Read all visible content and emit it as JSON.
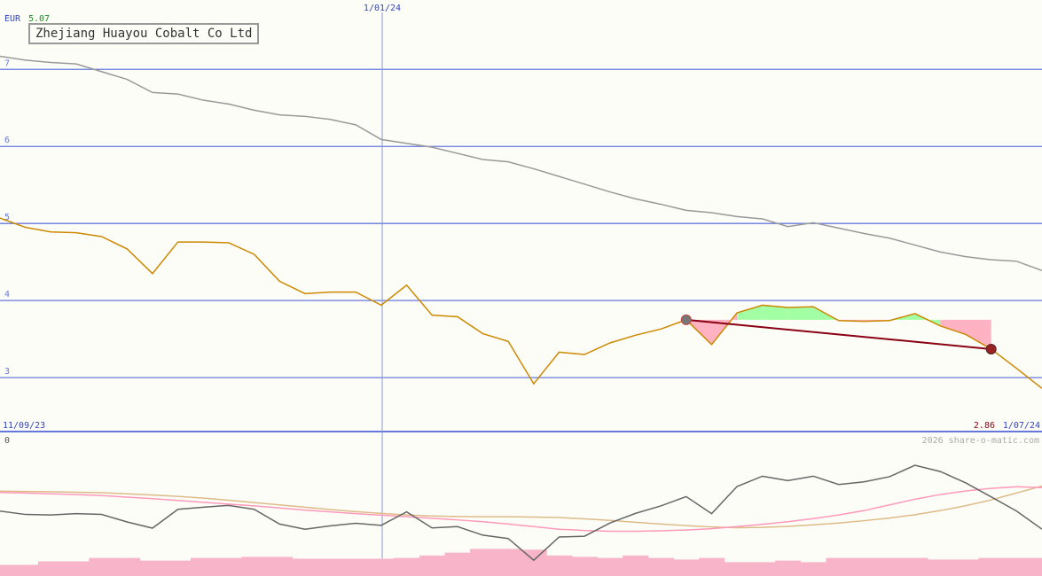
{
  "header": {
    "currency": "EUR",
    "last_price": "5.07",
    "company": "Zhejiang Huayou Cobalt Co Ltd",
    "start_date": "11/09/23",
    "end_date": "1/07/24",
    "end_price": "2.86",
    "marker_date": "1/01/24",
    "credit": "2026 share-o-matic.com"
  },
  "colors": {
    "price": "#cc8800",
    "average": "#999999",
    "gridline": "#6677dd",
    "trend": "#880011",
    "gain_fill": "#99ff99",
    "loss_fill": "#ffaabb",
    "osc_main": "#666666",
    "osc_pink": "#ff99bb",
    "osc_tan": "#ddbb88",
    "volume": "#f8b4c8",
    "date_text": "#3344bb",
    "price_text": "#228822"
  },
  "chart_data": [
    {
      "type": "line",
      "title": "Zhejiang Huayou Cobalt Co Ltd",
      "ylabel": "EUR",
      "ylim": [
        2.3,
        7.9
      ],
      "y_ticks": [
        "3",
        "4",
        "5",
        "6",
        "7"
      ],
      "x_range": [
        "11/09/23",
        "1/07/24"
      ],
      "x_marker": "1/01/24",
      "x": [
        0,
        1,
        2,
        3,
        4,
        5,
        6,
        7,
        8,
        9,
        10,
        11,
        12,
        13,
        14,
        15,
        16,
        17,
        18,
        19,
        20,
        21,
        22,
        23,
        24,
        25,
        26,
        27,
        28,
        29,
        30,
        31,
        32,
        33,
        34,
        35,
        36,
        37,
        38,
        39,
        40,
        41
      ],
      "series": [
        {
          "values": [
            5.07,
            4.95,
            4.89,
            4.88,
            4.83,
            4.67,
            4.35,
            4.76,
            4.76,
            4.75,
            4.6,
            4.25,
            4.09,
            4.11,
            4.11,
            3.94,
            4.2,
            3.81,
            3.79,
            3.57,
            3.47,
            2.92,
            3.33,
            3.3,
            3.45,
            3.55,
            3.63,
            3.75,
            3.43,
            3.84,
            3.94,
            3.91,
            3.92,
            3.74,
            3.73,
            3.74,
            3.83,
            3.67,
            3.56,
            3.37,
            3.12,
            2.86
          ]
        },
        {
          "values": [
            7.17,
            7.12,
            7.09,
            7.07,
            6.97,
            6.87,
            6.7,
            6.68,
            6.6,
            6.55,
            6.47,
            6.41,
            6.39,
            6.35,
            6.28,
            6.09,
            6.04,
            5.99,
            5.91,
            5.83,
            5.8,
            5.71,
            5.61,
            5.51,
            5.41,
            5.32,
            5.25,
            5.17,
            5.14,
            5.09,
            5.06,
            4.96,
            5.01,
            4.94,
            4.87,
            4.81,
            4.72,
            4.63,
            4.57,
            4.53,
            4.51,
            4.39
          ]
        }
      ],
      "trend_line": {
        "x": [
          27,
          39
        ],
        "y": [
          3.75,
          3.37
        ]
      }
    },
    {
      "type": "line",
      "ylim": [
        -50,
        0
      ],
      "y_ticks": [
        "0",
        "-50"
      ],
      "x": [
        0,
        1,
        2,
        3,
        4,
        5,
        6,
        7,
        8,
        9,
        10,
        11,
        12,
        13,
        14,
        15,
        16,
        17,
        18,
        19,
        20,
        21,
        22,
        23,
        24,
        25,
        26,
        27,
        28,
        29,
        30,
        31,
        32,
        33,
        34,
        35,
        36,
        37,
        38,
        39,
        40,
        41
      ],
      "series": [
        {
          "values": [
            -28,
            -29.3,
            -29.5,
            -29,
            -29.3,
            -32.2,
            -34.6,
            -27.3,
            -26.5,
            -25.8,
            -27.3,
            -33,
            -35,
            -33.7,
            -32.7,
            -33.5,
            -28.3,
            -34.5,
            -34,
            -37.3,
            -38.6,
            -47,
            -38,
            -37.7,
            -32.6,
            -28.9,
            -26,
            -22.4,
            -29,
            -18.5,
            -14.5,
            -16.2,
            -14.5,
            -17.7,
            -16.7,
            -14.7,
            -10.3,
            -12.7,
            -17.1,
            -22.5,
            -28,
            -35
          ]
        },
        {
          "values": [
            -20.8,
            -21,
            -21.3,
            -21.6,
            -22,
            -22.6,
            -23.2,
            -23.9,
            -24.6,
            -25.3,
            -26,
            -26.8,
            -27.6,
            -28.3,
            -29,
            -29.6,
            -30.2,
            -30.8,
            -31.4,
            -32.1,
            -33,
            -34,
            -35,
            -35.5,
            -35.8,
            -35.8,
            -35.6,
            -35.3,
            -34.8,
            -34,
            -33.1,
            -32.1,
            -30.9,
            -29.5,
            -27.8,
            -25.6,
            -23.4,
            -21.6,
            -20.2,
            -19.2,
            -18.6,
            -18.9
          ]
        },
        {
          "values": [
            -20.3,
            -20.4,
            -20.5,
            -20.7,
            -20.9,
            -21.3,
            -21.8,
            -22.3,
            -23,
            -23.8,
            -24.7,
            -25.6,
            -26.5,
            -27.4,
            -28.2,
            -28.9,
            -29.5,
            -29.9,
            -30.1,
            -30.2,
            -30.2,
            -30.3,
            -30.5,
            -31,
            -31.6,
            -32.3,
            -33,
            -33.6,
            -34.1,
            -34.4,
            -34.3,
            -33.9,
            -33.3,
            -32.6,
            -31.7,
            -30.7,
            -29.4,
            -27.8,
            -25.9,
            -23.7,
            -21,
            -18.3
          ]
        }
      ],
      "volume": [
        4.2,
        4.2,
        5.5,
        5.5,
        6.8,
        6.8,
        5.8,
        5.8,
        6.8,
        6.8,
        7.2,
        7.2,
        6.5,
        6.5,
        6.5,
        6.5,
        6.8,
        7.7,
        8.8,
        10.2,
        10.2,
        9.9,
        7.7,
        7.2,
        6.8,
        7.7,
        6.8,
        6.2,
        6.8,
        5.2,
        5.2,
        5.8,
        5.2,
        6.8,
        6.8,
        6.8,
        6.8,
        6.2,
        6.2,
        6.8,
        6.8,
        6.8
      ]
    }
  ]
}
